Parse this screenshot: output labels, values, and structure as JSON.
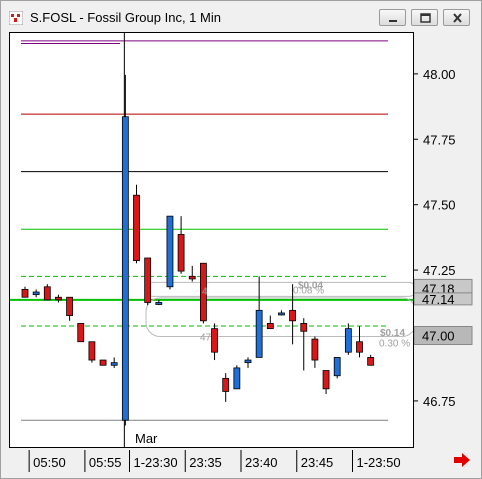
{
  "window": {
    "title": "S.FOSL - Fossil Group Inc, 1 Min"
  },
  "colors": {
    "bull": "#1f6fd6",
    "bear": "#d81818",
    "purple": "#800080",
    "darkred": "#b00000",
    "green": "#00c000",
    "gray": "#808080",
    "scroll_arrow": "#e00000"
  },
  "price_axis": {
    "ticks": [
      "48.00",
      "47.75",
      "47.50",
      "47.25",
      "47.00",
      "46.75"
    ],
    "tick_values": [
      48.0,
      47.75,
      47.5,
      47.25,
      47.0,
      46.75
    ],
    "markers": [
      {
        "label": "47.18",
        "value": 47.18
      },
      {
        "label": "47.14",
        "value": 47.14
      },
      {
        "label": "47.00",
        "value": 47.0
      }
    ]
  },
  "time_axis": {
    "ticks": [
      "05:50",
      "05:55",
      "1-23:30",
      "23:35",
      "23:40",
      "23:45",
      "1-23:50"
    ],
    "tick_indices": [
      1,
      6,
      10,
      15,
      20,
      25,
      30
    ]
  },
  "annotations": {
    "month_label": "Mar",
    "label_004": "$0.04",
    "label_008pct": "0.08 %",
    "label_014": "$0.14",
    "label_030pct": "0.30 %",
    "label_47": "47",
    "label_4": "4"
  },
  "chart_data": {
    "type": "candlestick",
    "ylim": [
      46.57,
      48.16
    ],
    "levels": [
      {
        "value": 48.13,
        "color": "purple"
      },
      {
        "value": 47.85,
        "color": "darkred"
      },
      {
        "value": 47.63,
        "color": "black"
      },
      {
        "value": 47.41,
        "color": "green"
      },
      {
        "value": 47.23,
        "color": "green-dashed"
      },
      {
        "value": 47.14,
        "color": "green"
      },
      {
        "value": 47.04,
        "color": "green-dashed"
      },
      {
        "value": 46.68,
        "color": "gray"
      }
    ],
    "candles": [
      {
        "i": 0,
        "o": 47.18,
        "h": 47.19,
        "l": 47.15,
        "c": 47.15
      },
      {
        "i": 1,
        "o": 47.16,
        "h": 47.18,
        "l": 47.15,
        "c": 47.17
      },
      {
        "i": 2,
        "o": 47.19,
        "h": 47.2,
        "l": 47.14,
        "c": 47.14
      },
      {
        "i": 3,
        "o": 47.15,
        "h": 47.16,
        "l": 47.13,
        "c": 47.14
      },
      {
        "i": 4,
        "o": 47.15,
        "h": 47.15,
        "l": 47.06,
        "c": 47.08
      },
      {
        "i": 5,
        "o": 47.05,
        "h": 47.05,
        "l": 46.98,
        "c": 46.98
      },
      {
        "i": 6,
        "o": 46.98,
        "h": 46.98,
        "l": 46.9,
        "c": 46.91
      },
      {
        "i": 7,
        "o": 46.91,
        "h": 46.91,
        "l": 46.89,
        "c": 46.89
      },
      {
        "i": 8,
        "o": 46.89,
        "h": 46.92,
        "l": 46.88,
        "c": 46.9
      },
      {
        "i": 9,
        "o": 46.68,
        "h": 48.0,
        "l": 46.66,
        "c": 47.84
      },
      {
        "i": 10,
        "o": 47.54,
        "h": 47.58,
        "l": 47.28,
        "c": 47.29
      },
      {
        "i": 11,
        "o": 47.3,
        "h": 47.3,
        "l": 47.12,
        "c": 47.13
      },
      {
        "i": 12,
        "o": 47.13,
        "h": 47.14,
        "l": 47.12,
        "c": 47.13
      },
      {
        "i": 13,
        "o": 47.19,
        "h": 47.46,
        "l": 47.18,
        "c": 47.46
      },
      {
        "i": 14,
        "o": 47.39,
        "h": 47.46,
        "l": 47.24,
        "c": 47.25
      },
      {
        "i": 15,
        "o": 47.23,
        "h": 47.27,
        "l": 47.21,
        "c": 47.22
      },
      {
        "i": 16,
        "o": 47.28,
        "h": 47.28,
        "l": 47.05,
        "c": 47.06
      },
      {
        "i": 17,
        "o": 47.03,
        "h": 47.05,
        "l": 46.91,
        "c": 46.94
      },
      {
        "i": 18,
        "o": 46.84,
        "h": 46.86,
        "l": 46.75,
        "c": 46.79
      },
      {
        "i": 19,
        "o": 46.8,
        "h": 46.89,
        "l": 46.8,
        "c": 46.88
      },
      {
        "i": 20,
        "o": 46.9,
        "h": 46.92,
        "l": 46.88,
        "c": 46.91
      },
      {
        "i": 21,
        "o": 46.92,
        "h": 47.23,
        "l": 46.92,
        "c": 47.1
      },
      {
        "i": 22,
        "o": 47.05,
        "h": 47.08,
        "l": 47.03,
        "c": 47.03
      },
      {
        "i": 23,
        "o": 47.09,
        "h": 47.1,
        "l": 47.08,
        "c": 47.09
      },
      {
        "i": 24,
        "o": 47.1,
        "h": 47.2,
        "l": 46.97,
        "c": 47.06
      },
      {
        "i": 25,
        "o": 47.05,
        "h": 47.07,
        "l": 46.87,
        "c": 47.02
      },
      {
        "i": 26,
        "o": 46.99,
        "h": 47.0,
        "l": 46.88,
        "c": 46.91
      },
      {
        "i": 27,
        "o": 46.87,
        "h": 46.87,
        "l": 46.78,
        "c": 46.8
      },
      {
        "i": 28,
        "o": 46.85,
        "h": 46.92,
        "l": 46.84,
        "c": 46.92
      },
      {
        "i": 29,
        "o": 46.94,
        "h": 47.05,
        "l": 46.93,
        "c": 47.03
      },
      {
        "i": 30,
        "o": 46.98,
        "h": 47.04,
        "l": 46.92,
        "c": 46.94
      },
      {
        "i": 31,
        "o": 46.92,
        "h": 46.93,
        "l": 46.89,
        "c": 46.89
      }
    ]
  }
}
